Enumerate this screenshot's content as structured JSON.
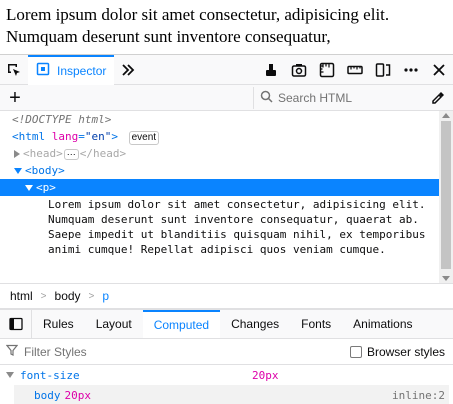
{
  "page": {
    "paragraph": "Lorem ipsum dolor sit amet consectetur, adipisicing elit. Numquam deserunt sunt inventore consequatur,"
  },
  "toolbox": {
    "inspector_tab": "Inspector"
  },
  "markup_toolbar": {
    "search_placeholder": "Search HTML"
  },
  "markup": {
    "doctype": "<!DOCTYPE html>",
    "html_open_tag": "<html",
    "html_attr_name": "lang",
    "html_attr_eq": "=",
    "html_attr_value": "\"en\"",
    "html_close": ">",
    "event_badge": "event",
    "head_open": "<head>",
    "head_ellipsis": "⋯",
    "head_close": "</head>",
    "body_open": "<body>",
    "p_open": "<p>",
    "p_text": "Lorem ipsum dolor sit amet consectetur, adipisicing elit. Numquam deserunt sunt inventore consequatur, quaerat ab. Saepe impedit ut blanditiis quisquam nihil, ex temporibus animi cumque! Repellat adipisci quos veniam cumque."
  },
  "breadcrumbs": [
    "html",
    "body",
    "p"
  ],
  "sidebar": {
    "tabs": [
      "Rules",
      "Layout",
      "Computed",
      "Changes",
      "Fonts",
      "Animations"
    ],
    "active_tab": "Computed",
    "filter_placeholder": "Filter Styles",
    "browser_styles_label": "Browser styles"
  },
  "computed": {
    "property": "font-size",
    "value": "20px",
    "source_selector": "body",
    "source_value": "20px",
    "source_location": "inline:2"
  },
  "colors": {
    "accent": "#0a84ff",
    "tag": "#0074e8",
    "attr": "#dd00a9"
  },
  "icons": [
    "element-picker-icon",
    "inspector-icon",
    "more-tools-icon",
    "paint-flashing-icon",
    "screenshot-icon",
    "rulers-icon",
    "measure-icon",
    "responsive-design-icon",
    "menu-icon",
    "close-icon",
    "plus-icon",
    "search-icon",
    "eyedropper-icon",
    "layout-toggle-icon",
    "filter-icon"
  ]
}
